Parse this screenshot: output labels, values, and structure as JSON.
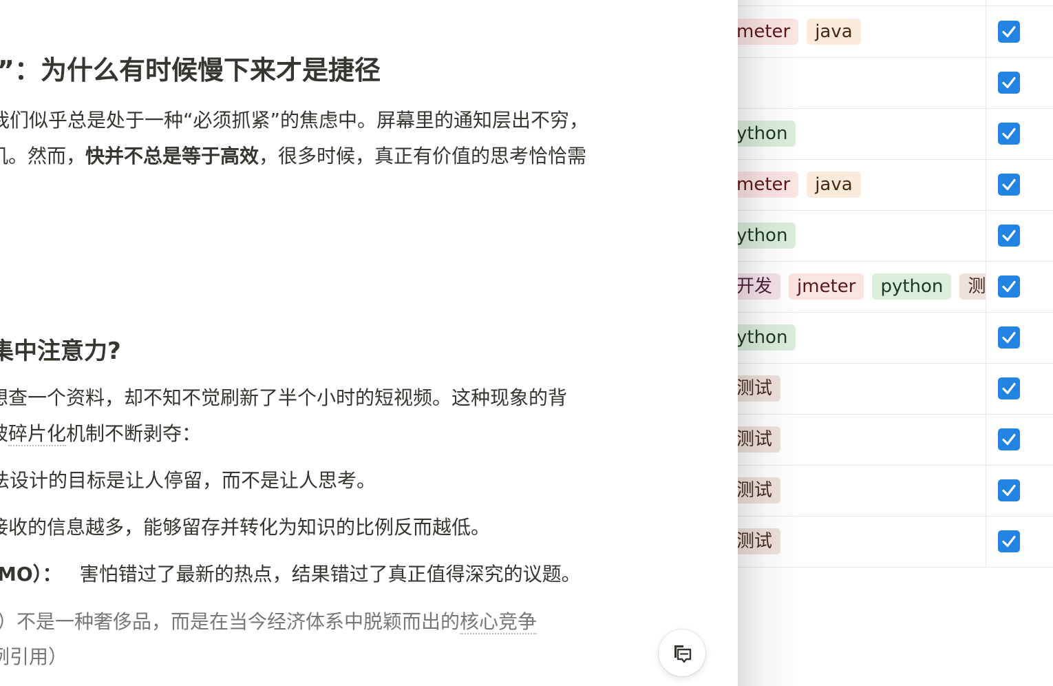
{
  "article": {
    "heading_1": "”：为什么有时候慢下来才是捷径",
    "intro_line_1": "我们似乎总是处于一种“必须抓紧”的焦虑中。屏幕里的通知层出不穷，",
    "intro_line_2_pre": "机。然而，",
    "intro_line_2_bold": "快并不总是等于高效",
    "intro_line_2_post": "，很多时候，真正有价值的思考恰恰需",
    "heading_2": "集中注意力?",
    "para2_line_1": "想查一个资料，却不知不觉刷新了半个小时的短视频。这种现象的背",
    "para2_line_2_pre": "被",
    "para2_line_2_dotted": "碎片化",
    "para2_line_2_post": "机制不断剥夺：",
    "bullet_1": "法设计的目标是让人停留，而不是让人思考。",
    "bullet_2": "接收的信息越多，能够留存并转化为知识的比例反而越低。",
    "bullet_3_bold": "MO）：",
    "bullet_3_text": "害怕错过了最新的热点，结果错过了真正值得深究的议题。",
    "quote_line_1_pre": "）不是一种奢侈品，而是在当今经济体系中脱颖而出的",
    "quote_line_1_dotted": "核心竞争",
    "quote_line_2": "例引用）"
  },
  "comment_button": {
    "icon": "comment-icon"
  },
  "table": {
    "rows": [
      {
        "tags": [
          {
            "label": "meter",
            "color": "red"
          },
          {
            "label": "java",
            "color": "orange"
          }
        ],
        "checked": true
      },
      {
        "tags": [],
        "checked": true
      },
      {
        "tags": [
          {
            "label": "ython",
            "color": "green"
          }
        ],
        "checked": true
      },
      {
        "tags": [
          {
            "label": "meter",
            "color": "red"
          },
          {
            "label": "java",
            "color": "orange"
          }
        ],
        "checked": true
      },
      {
        "tags": [
          {
            "label": "ython",
            "color": "green"
          }
        ],
        "checked": true
      },
      {
        "tags": [
          {
            "label": "开发",
            "color": "pink"
          },
          {
            "label": "jmeter",
            "color": "red"
          },
          {
            "label": "python",
            "color": "green"
          },
          {
            "label": "测",
            "color": "brown"
          }
        ],
        "checked": true
      },
      {
        "tags": [
          {
            "label": "ython",
            "color": "green"
          }
        ],
        "checked": true
      },
      {
        "tags": [
          {
            "label": "测试",
            "color": "brown"
          }
        ],
        "checked": true
      },
      {
        "tags": [
          {
            "label": "测试",
            "color": "brown"
          }
        ],
        "checked": true
      },
      {
        "tags": [
          {
            "label": "测试",
            "color": "brown"
          }
        ],
        "checked": true
      },
      {
        "tags": [
          {
            "label": "测试",
            "color": "brown"
          }
        ],
        "checked": true
      }
    ],
    "colors": {
      "checkbox": "#2383e2",
      "tag_red": "#fbe4e4",
      "tag_orange": "#faebdd",
      "tag_green": "#dbeddb",
      "tag_brown": "#eee0da",
      "tag_pink": "#f5e0e9"
    }
  }
}
